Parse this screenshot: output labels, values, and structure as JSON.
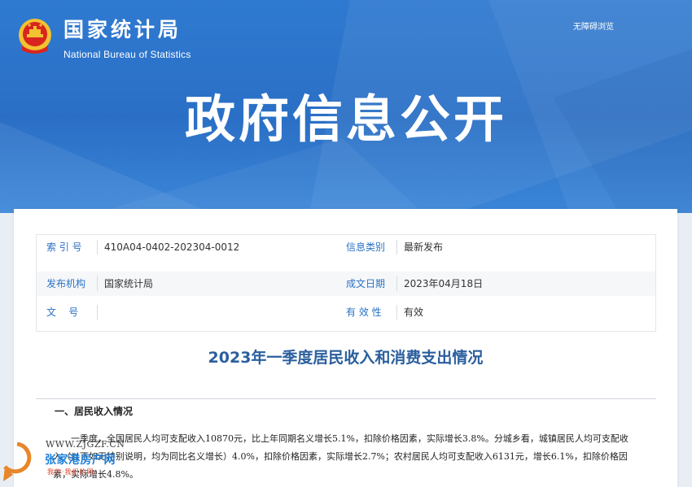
{
  "header": {
    "logo_cn": "国家统计局",
    "logo_en": "National Bureau of Statistics",
    "accessibility_link": "无障碍浏览",
    "hero_title": "政府信息公开"
  },
  "meta": {
    "rows": [
      {
        "left_label": "索 引 号",
        "left_value": "410A04-0402-202304-0012",
        "right_label": "信息类别",
        "right_value": "最新发布"
      },
      {
        "left_label": "发布机构",
        "left_value": "国家统计局",
        "right_label": "成文日期",
        "right_value": "2023年04月18日"
      },
      {
        "left_label": "文    号",
        "left_value": "",
        "right_label": "有 效 性",
        "right_value": "有效"
      }
    ]
  },
  "article": {
    "title": "2023年一季度居民收入和消费支出情况",
    "section_heading": "一、居民收入情况",
    "paragraph": "一季度，全国居民人均可支配收入10870元，比上年同期名义增长5.1%，扣除价格因素，实际增长3.8%。分城乡看，城镇居民人均可支配收入（以下如无特别说明，均为同比名义增长）4.0%，扣除价格因素，实际增长2.7%；农村居民人均可支配收入6131元，增长6.1%，扣除价格因素，实际增长4.8%。"
  },
  "watermark": {
    "url": "WWW.ZJGZF.CN",
    "name": "张家港房产网",
    "tag": "我的·我们的网"
  },
  "colors": {
    "banner": "#2a6fc5",
    "label_blue": "#2b72c4",
    "title_blue": "#2b5f9e"
  }
}
